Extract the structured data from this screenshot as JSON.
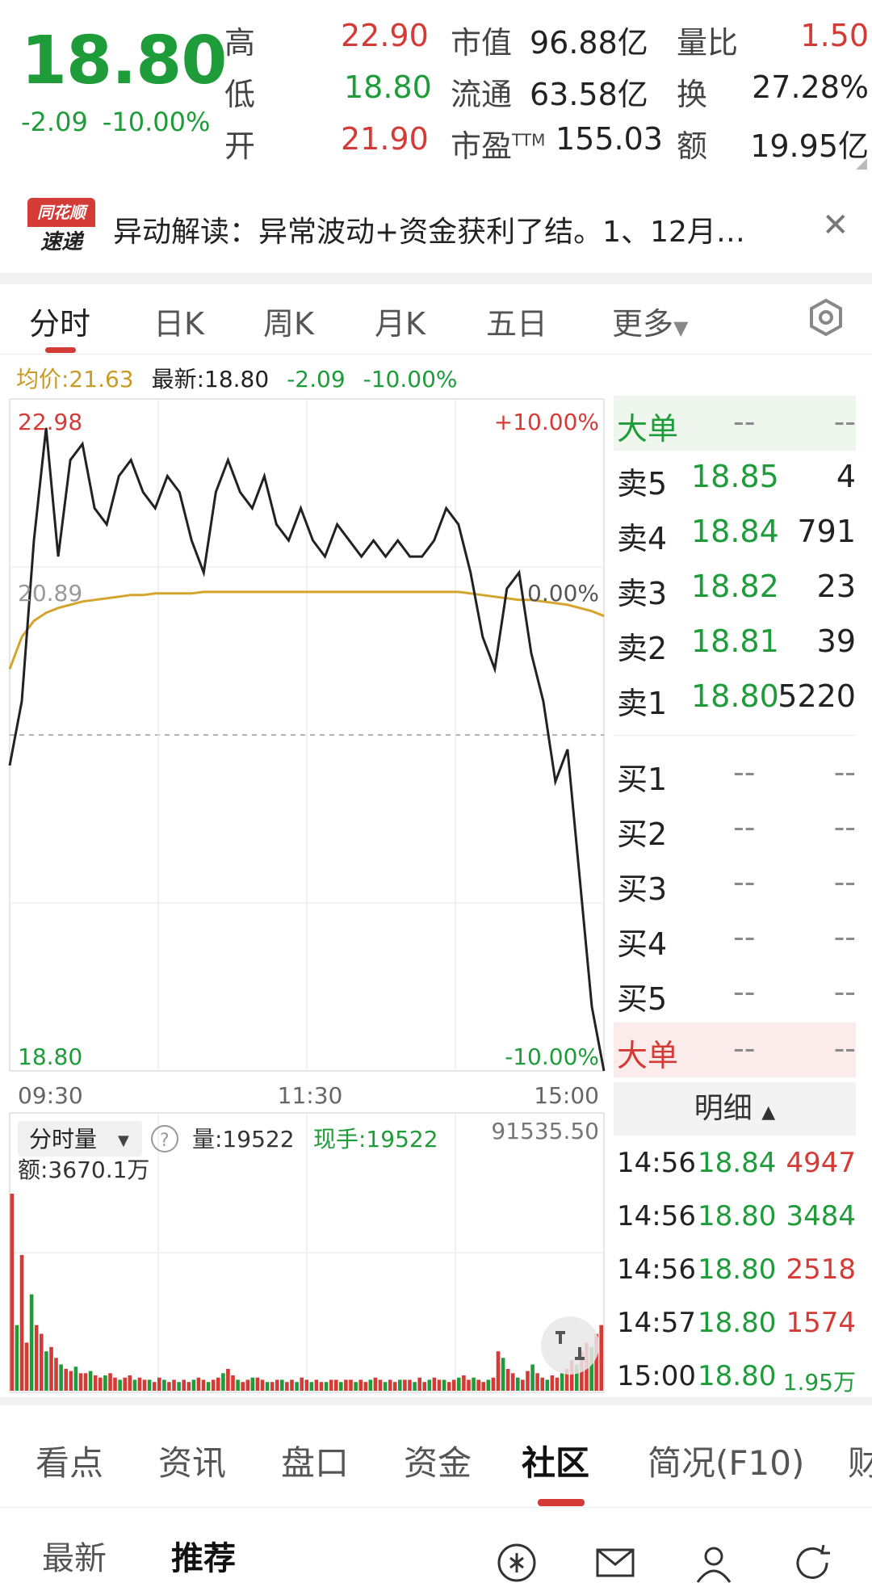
{
  "quote": {
    "price": "18.80",
    "change": "-2.09",
    "change_pct": "-10.00%",
    "fields": [
      {
        "label": "高",
        "value": "22.90",
        "color": "red"
      },
      {
        "label": "低",
        "value": "18.80",
        "color": "green"
      },
      {
        "label": "开",
        "value": "21.90",
        "color": "red"
      },
      {
        "label": "市值",
        "value": "96.88亿",
        "color": "black"
      },
      {
        "label": "流通",
        "value": "63.58亿",
        "color": "black"
      },
      {
        "label": "市盈",
        "label_sup": "TTM",
        "value": "155.03",
        "color": "black"
      },
      {
        "label": "量比",
        "value": "1.50",
        "color": "red"
      },
      {
        "label": "换",
        "value": "27.28%",
        "color": "black"
      },
      {
        "label": "额",
        "value": "19.95亿",
        "color": "black"
      }
    ]
  },
  "banner": {
    "logo_top": "同花顺",
    "logo_bottom": "速递",
    "text": "异动解读：异常波动+资金获利了结。1、12月…",
    "close_icon": "close-icon"
  },
  "tabs": [
    "分时",
    "日K",
    "周K",
    "月K",
    "五日",
    "更多"
  ],
  "active_tab": 0,
  "info_line": {
    "avg_label": "均价:21.63",
    "latest_label": "最新:18.80",
    "change": "-2.09",
    "change_pct": "-10.00%"
  },
  "chart_data": {
    "type": "line",
    "series": [
      {
        "name": "最新",
        "values": [
          20.7,
          21.1,
          22.1,
          22.8,
          22.0,
          22.6,
          22.7,
          22.3,
          22.2,
          22.5,
          22.6,
          22.4,
          22.3,
          22.5,
          22.4,
          22.1,
          21.9,
          22.4,
          22.6,
          22.4,
          22.3,
          22.5,
          22.2,
          22.1,
          22.3,
          22.1,
          22.0,
          22.2,
          22.1,
          22.0,
          22.1,
          22.0,
          22.1,
          22.0,
          22.0,
          22.1,
          22.3,
          22.2,
          21.9,
          21.5,
          21.3,
          21.8,
          21.9,
          21.4,
          21.1,
          20.6,
          20.8,
          20.0,
          19.2,
          18.8
        ]
      },
      {
        "name": "均价",
        "values": [
          21.3,
          21.5,
          21.6,
          21.65,
          21.68,
          21.7,
          21.72,
          21.73,
          21.74,
          21.75,
          21.76,
          21.76,
          21.77,
          21.77,
          21.77,
          21.77,
          21.78,
          21.78,
          21.78,
          21.78,
          21.78,
          21.78,
          21.78,
          21.78,
          21.78,
          21.78,
          21.78,
          21.78,
          21.78,
          21.78,
          21.78,
          21.78,
          21.78,
          21.78,
          21.78,
          21.78,
          21.78,
          21.78,
          21.77,
          21.76,
          21.75,
          21.74,
          21.73,
          21.73,
          21.72,
          21.71,
          21.7,
          21.68,
          21.66,
          21.63
        ]
      }
    ],
    "ylim": [
      18.8,
      22.98
    ],
    "ref_price": 20.89,
    "y_labels": {
      "top": "22.98",
      "mid": "20.89",
      "bottom": "18.80"
    },
    "pct_labels": {
      "top": "+10.00%",
      "mid": "0.00%",
      "bottom": "-10.00%"
    },
    "x_labels": [
      "09:30",
      "11:30",
      "15:00"
    ],
    "grid": true,
    "volume": {
      "label": "分时量",
      "vol_label": "量:19522",
      "now_label": "现手:19522",
      "max_label": "91535.50",
      "amount_label": "额:3670.1万",
      "values": [
        90,
        30,
        62,
        22,
        44,
        30,
        26,
        18,
        20,
        15,
        12,
        10,
        9,
        11,
        8,
        8,
        9,
        7,
        6,
        7,
        8,
        6,
        5,
        6,
        7,
        5,
        6,
        5,
        5,
        4,
        6,
        5,
        4,
        5,
        4,
        5,
        4,
        5,
        6,
        5,
        4,
        5,
        6,
        8,
        10,
        7,
        5,
        4,
        5,
        6,
        6,
        5,
        4,
        4,
        5,
        5,
        4,
        5,
        4,
        6,
        5,
        4,
        5,
        4,
        4,
        5,
        5,
        4,
        5,
        5,
        4,
        5,
        4,
        5,
        6,
        5,
        4,
        5,
        4,
        5,
        5,
        5,
        4,
        6,
        4,
        5,
        6,
        5,
        5,
        4,
        5,
        6,
        7,
        5,
        6,
        5,
        4,
        5,
        6,
        18,
        15,
        10,
        8,
        6,
        5,
        9,
        12,
        8,
        6,
        5,
        7,
        6,
        8,
        10,
        14,
        12,
        18,
        22,
        20,
        26,
        30
      ]
    }
  },
  "order_book": {
    "big_label": "大单",
    "dash": "--",
    "sell": [
      {
        "label": "卖5",
        "price": "18.85",
        "vol": "4"
      },
      {
        "label": "卖4",
        "price": "18.84",
        "vol": "791"
      },
      {
        "label": "卖3",
        "price": "18.82",
        "vol": "23"
      },
      {
        "label": "卖2",
        "price": "18.81",
        "vol": "39"
      },
      {
        "label": "卖1",
        "price": "18.80",
        "vol": "5220"
      }
    ],
    "buy": [
      {
        "label": "买1",
        "price": "--",
        "vol": "--"
      },
      {
        "label": "买2",
        "price": "--",
        "vol": "--"
      },
      {
        "label": "买3",
        "price": "--",
        "vol": "--"
      },
      {
        "label": "买4",
        "price": "--",
        "vol": "--"
      },
      {
        "label": "买5",
        "price": "--",
        "vol": "--"
      }
    ]
  },
  "details": {
    "title": "明细",
    "rows": [
      {
        "time": "14:56",
        "price": "18.84",
        "vol": "4947",
        "vol_color": "red"
      },
      {
        "time": "14:56",
        "price": "18.80",
        "vol": "3484",
        "vol_color": "green"
      },
      {
        "time": "14:56",
        "price": "18.80",
        "vol": "2518",
        "vol_color": "red"
      },
      {
        "time": "14:57",
        "price": "18.80",
        "vol": "1574",
        "vol_color": "red"
      },
      {
        "time": "15:00",
        "price": "18.80",
        "vol": "1.95万",
        "vol_color": "green"
      }
    ]
  },
  "bottom_tabs": [
    "看点",
    "资讯",
    "盘口",
    "资金",
    "社区",
    "简况(F10)",
    "财"
  ],
  "bottom_active": 4,
  "sub_tabs": [
    "最新",
    "推荐"
  ],
  "sub_active": 1,
  "colors": {
    "red": "#d43a36",
    "green": "#1f9c3a",
    "gold": "#c89b26"
  }
}
